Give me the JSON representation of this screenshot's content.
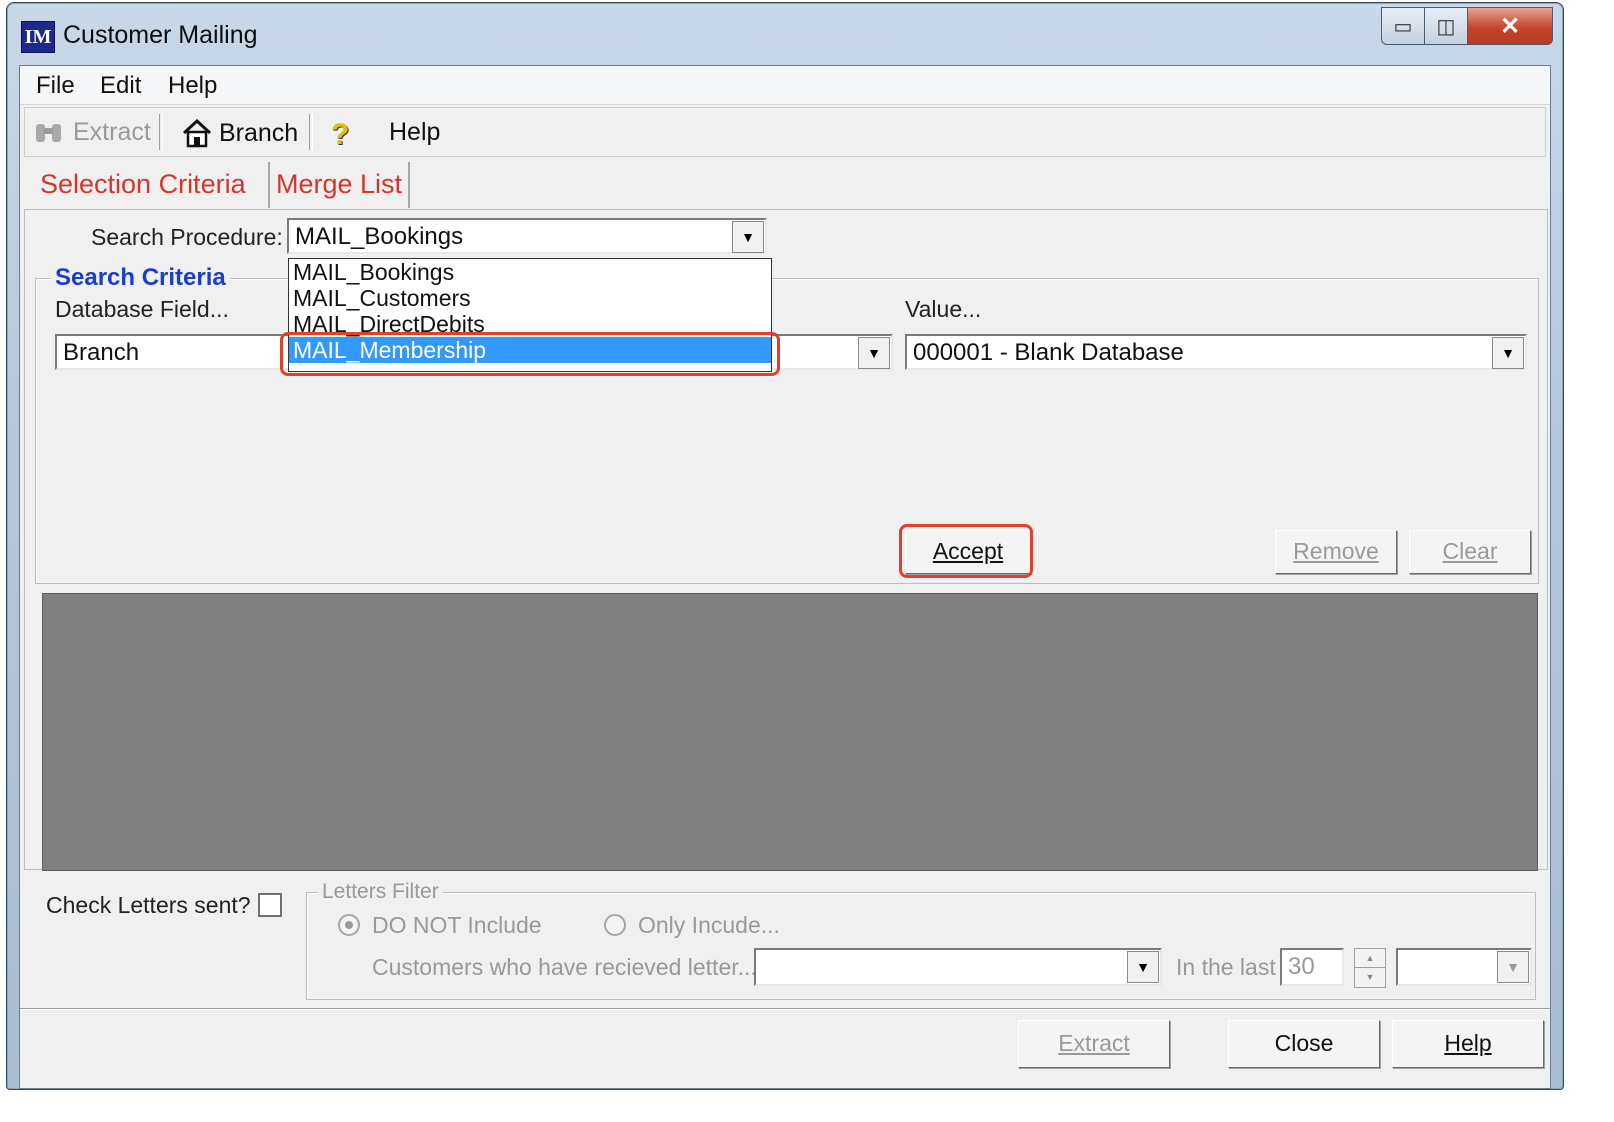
{
  "window": {
    "title": "Customer Mailing",
    "logo_text": "IM"
  },
  "caption_buttons": {
    "minimize": "▭",
    "maximize": "◫",
    "close": "✕"
  },
  "menu": {
    "file": "File",
    "edit": "Edit",
    "help": "Help"
  },
  "toolbar": {
    "extract": "Extract",
    "branch": "Branch",
    "help_icon": "?",
    "help": "Help"
  },
  "tabs": {
    "selection_criteria": "Selection Criteria",
    "merge_list": "Merge List"
  },
  "search_procedure": {
    "label": "Search Procedure:",
    "value": "MAIL_Bookings",
    "options": [
      "MAIL_Bookings",
      "MAIL_Customers",
      "MAIL_DirectDebits",
      "MAIL_Membership"
    ],
    "highlighted": "MAIL_Membership"
  },
  "search_criteria": {
    "title": "Search Criteria",
    "database_field_label": "Database Field...",
    "database_field_value": "Branch",
    "value_label": "Value...",
    "value_value": "000001 - Blank Database"
  },
  "buttons": {
    "accept": "Accept",
    "remove": "Remove",
    "clear": "Clear",
    "extract": "Extract",
    "close": "Close",
    "help": "Help"
  },
  "letters": {
    "check_label": "Check Letters sent?",
    "filter_title": "Letters Filter",
    "do_not_include": "DO NOT Include",
    "only_include": "Only Incude...",
    "received_label": "Customers who have recieved letter...",
    "in_the_last": "In the last",
    "days_value": "30"
  },
  "colors": {
    "tab_text": "#d3362c",
    "group_title": "#1a3fc4",
    "selection": "#3399ff",
    "annotation": "#e0402c"
  }
}
